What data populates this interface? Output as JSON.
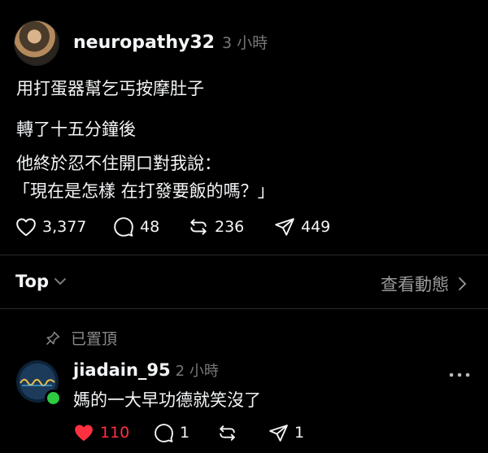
{
  "post": {
    "username": "neuropathy32",
    "time": "3 小時",
    "lines": [
      "用打蛋器幫乞丐按摩肚子",
      "轉了十五分鐘後",
      "他終於忍不住開口對我說：",
      "「現在是怎樣 在打發要飯的嗎？」"
    ],
    "actions": {
      "likes": "3,377",
      "comments": "48",
      "reposts": "236",
      "shares": "449"
    }
  },
  "replies_header": {
    "sort_label": "Top",
    "activity_label": "查看動態"
  },
  "comment": {
    "pinned_label": "已置頂",
    "username": "jiadain_95",
    "time": "2 小時",
    "text": "媽的一大早功德就笑沒了",
    "likes": "110",
    "comments": "1",
    "shares": "1",
    "liked_color": "#ff3040"
  }
}
